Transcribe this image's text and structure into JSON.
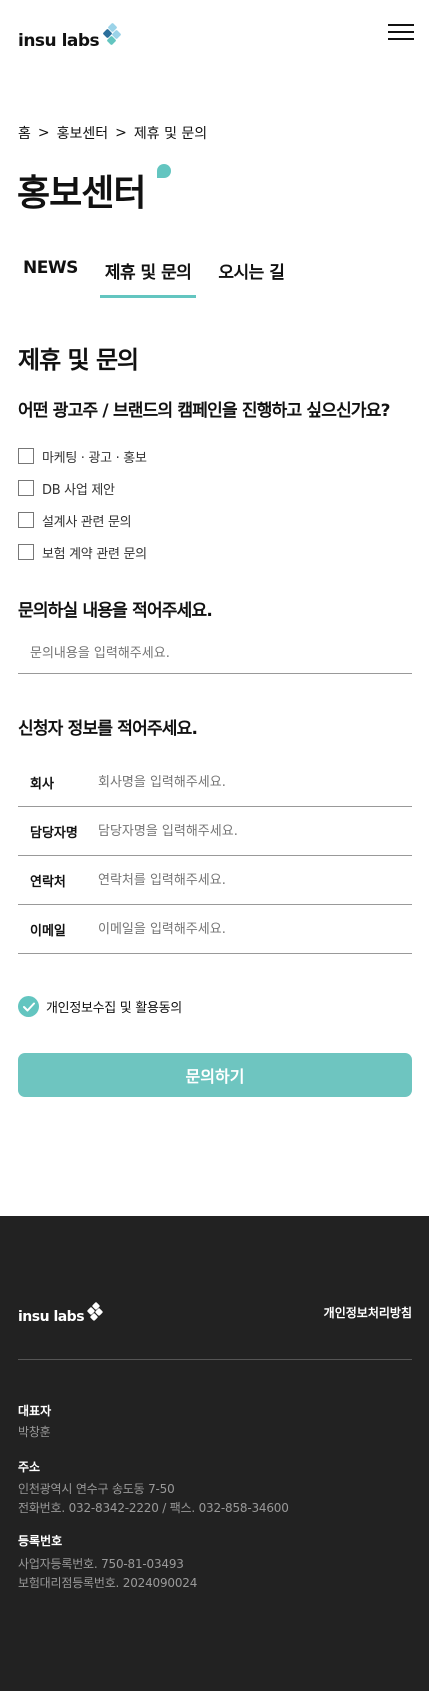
{
  "header": {
    "logo_text": "insu labs",
    "brand_colors": {
      "teal": "#63c5c0",
      "sky": "#9bd3e8",
      "navy": "#2a6f9b"
    },
    "menu_icon": "hamburger-icon"
  },
  "breadcrumb": {
    "items": [
      "홈",
      "홍보센터",
      "제휴 및 문의"
    ],
    "separator": ">"
  },
  "page_title": "홍보센터",
  "tabs": [
    {
      "label": "NEWS",
      "active": false
    },
    {
      "label": "제휴 및 문의",
      "active": true
    },
    {
      "label": "오시는 길",
      "active": false
    }
  ],
  "form": {
    "section_title": "제휴 및 문의",
    "question": "어떤 광고주 / 브랜드의 캠페인을 진행하고 싶으신가요?",
    "options": [
      {
        "label": "마케팅 · 광고 · 홍보",
        "checked": false
      },
      {
        "label": "DB 사업 제안",
        "checked": false
      },
      {
        "label": "설계사 관련 문의",
        "checked": false
      },
      {
        "label": "보험 계약 관련 문의",
        "checked": false
      }
    ],
    "content_title": "문의하실 내용을 적어주세요.",
    "content_placeholder": "문의내용을 입력해주세요.",
    "applicant_title": "신청자 정보를 적어주세요.",
    "fields": [
      {
        "label": "회사",
        "placeholder": "회사명을 입력해주세요."
      },
      {
        "label": "담당자명",
        "placeholder": "담당자명을 입력해주세요."
      },
      {
        "label": "연락처",
        "placeholder": "연락처를 입력해주세요."
      },
      {
        "label": "이메일",
        "placeholder": "이메일을 입력해주세요."
      }
    ],
    "consent_label": "개인정보수집 및 활용동의",
    "consent_checked": true,
    "submit_label": "문의하기",
    "accent_color": "#63c5c0"
  },
  "footer": {
    "logo_text": "insu labs",
    "privacy_link": "개인정보처리방침",
    "ceo_label": "대표자",
    "ceo_value": "박창훈",
    "address_label": "주소",
    "address_value": "인천광역시 연수구 송도동 7-50",
    "phone_value": "전화번호. 032-8342-2220 / 팩스. 032-858-34600",
    "reg_label": "등록번호",
    "biz_reg_value": "사업자등록번호. 750-81-03493",
    "agency_reg_value": "보험대리점등록번호. 2024090024",
    "background": "#222222"
  }
}
